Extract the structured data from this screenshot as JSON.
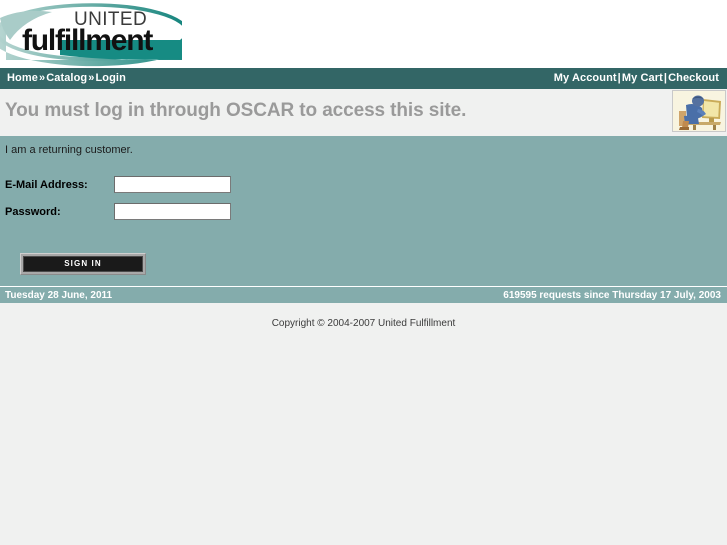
{
  "brand": {
    "logo_word_top": "UNITED",
    "logo_word_main": "fulfillment",
    "accent_teal": "#1E8B84",
    "accent_teal_light": "#8FC0BC"
  },
  "nav": {
    "breadcrumb": [
      {
        "label": "Home",
        "name": "breadcrumb-home"
      },
      {
        "label": "Catalog",
        "name": "breadcrumb-catalog"
      },
      {
        "label": "Login",
        "name": "breadcrumb-login"
      }
    ],
    "breadcrumb_separator": "»",
    "links": [
      {
        "label": "My Account",
        "name": "nav-my-account"
      },
      {
        "label": "My Cart",
        "name": "nav-my-cart"
      },
      {
        "label": "Checkout",
        "name": "nav-checkout"
      }
    ],
    "link_separator": "|",
    "bar_color": "#336666"
  },
  "page": {
    "title": "You must log in through OSCAR to access this site.",
    "title_color": "#9a9a9a",
    "icon": "person-at-computer-icon"
  },
  "login": {
    "intro": "I am a returning customer.",
    "panel_color": "#84acac",
    "fields": [
      {
        "label": "E-Mail Address:",
        "value": "",
        "placeholder": "",
        "name": "email-field",
        "type": "text"
      },
      {
        "label": "Password:",
        "value": "",
        "placeholder": "",
        "name": "password-field",
        "type": "password"
      }
    ],
    "submit_label": "SIGN IN"
  },
  "footer": {
    "date": "Tuesday 28 June, 2011",
    "requests": "619595 requests since Thursday 17 July, 2003",
    "copyright": "Copyright © 2004-2007 United Fulfillment"
  }
}
